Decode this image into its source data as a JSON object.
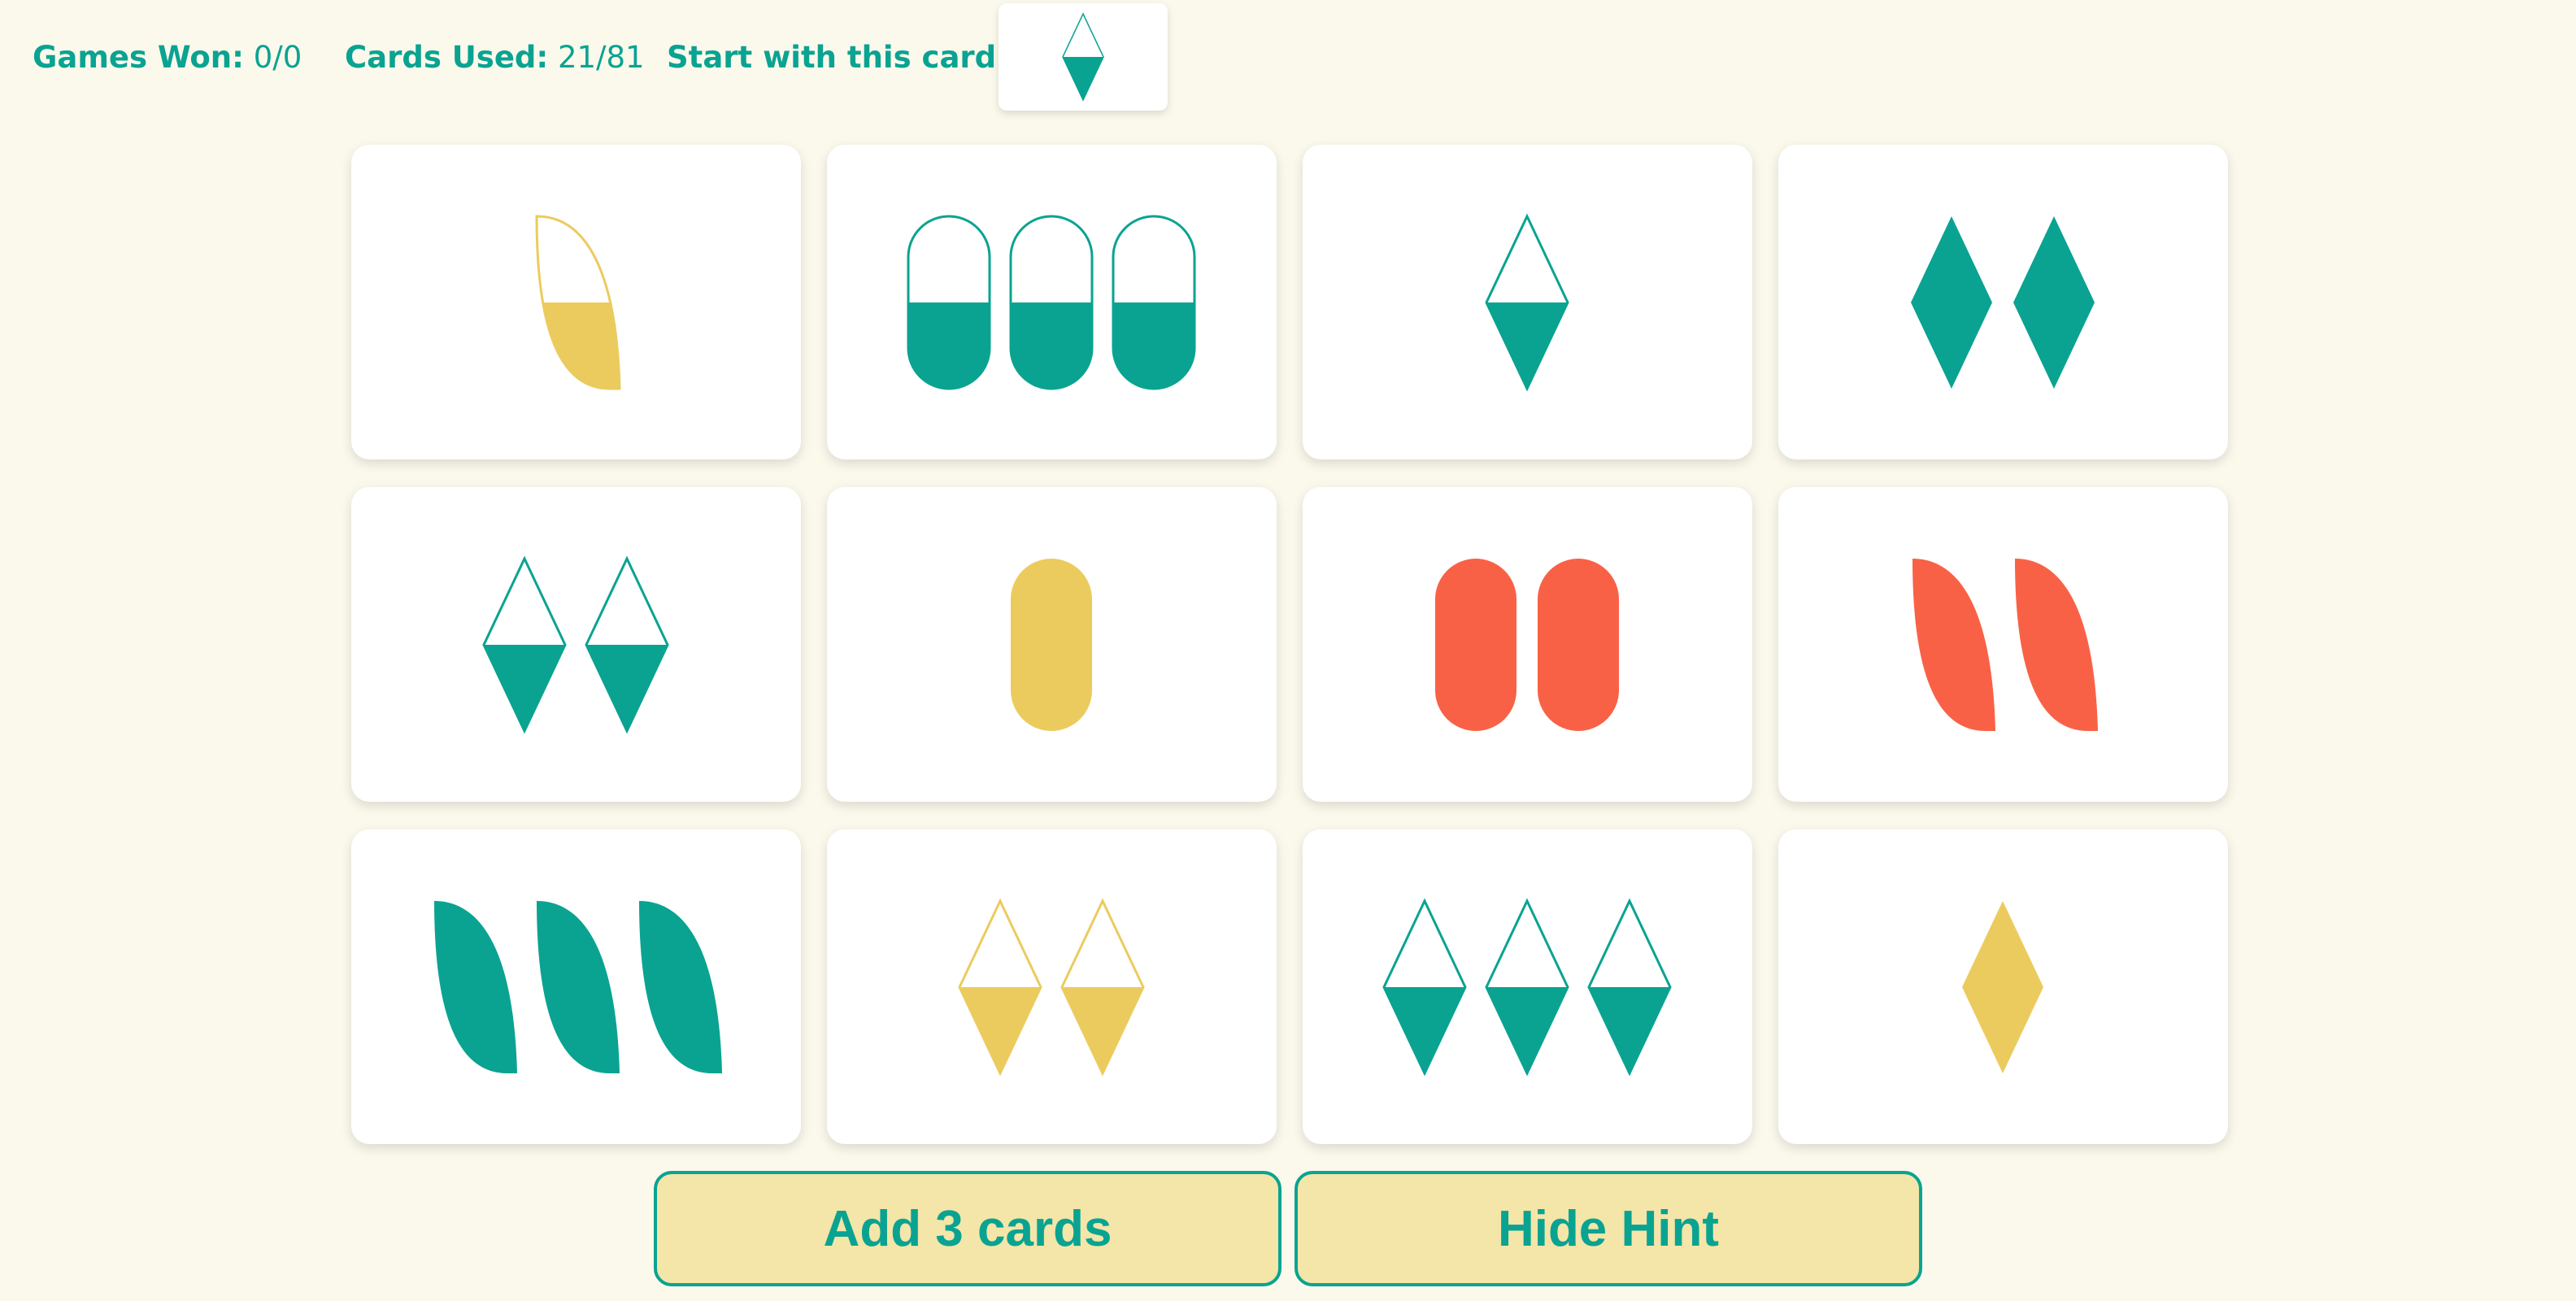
{
  "stats": {
    "games_won_label": "Games Won:",
    "games_won_value": "0/0",
    "cards_used_label": "Cards Used:",
    "cards_used_value": "21/81",
    "start_label": "Start with this card:"
  },
  "start_card": {
    "count": 1,
    "shape": "diamond",
    "fill": "striped",
    "color": "teal"
  },
  "colors": {
    "teal": "#0aa391",
    "yellow": "#eccb5e",
    "red": "#f96146",
    "card": "#ffffff",
    "background": "#fbf9ec",
    "button_bg": "#f4e5a8"
  },
  "cards": [
    {
      "count": 1,
      "shape": "leaf",
      "fill": "striped",
      "color": "yellow"
    },
    {
      "count": 3,
      "shape": "oval",
      "fill": "striped",
      "color": "teal"
    },
    {
      "count": 1,
      "shape": "diamond",
      "fill": "striped",
      "color": "teal"
    },
    {
      "count": 2,
      "shape": "diamond",
      "fill": "solid",
      "color": "teal"
    },
    {
      "count": 2,
      "shape": "diamond",
      "fill": "striped",
      "color": "teal"
    },
    {
      "count": 1,
      "shape": "oval",
      "fill": "solid",
      "color": "yellow"
    },
    {
      "count": 2,
      "shape": "oval",
      "fill": "solid",
      "color": "red"
    },
    {
      "count": 2,
      "shape": "leaf",
      "fill": "solid",
      "color": "red"
    },
    {
      "count": 3,
      "shape": "leaf",
      "fill": "solid",
      "color": "teal"
    },
    {
      "count": 2,
      "shape": "diamond",
      "fill": "striped",
      "color": "yellow"
    },
    {
      "count": 3,
      "shape": "diamond",
      "fill": "striped",
      "color": "teal"
    },
    {
      "count": 1,
      "shape": "diamond",
      "fill": "solid",
      "color": "yellow"
    }
  ],
  "buttons": {
    "add_label": "Add 3 cards",
    "hint_label": "Hide Hint"
  }
}
